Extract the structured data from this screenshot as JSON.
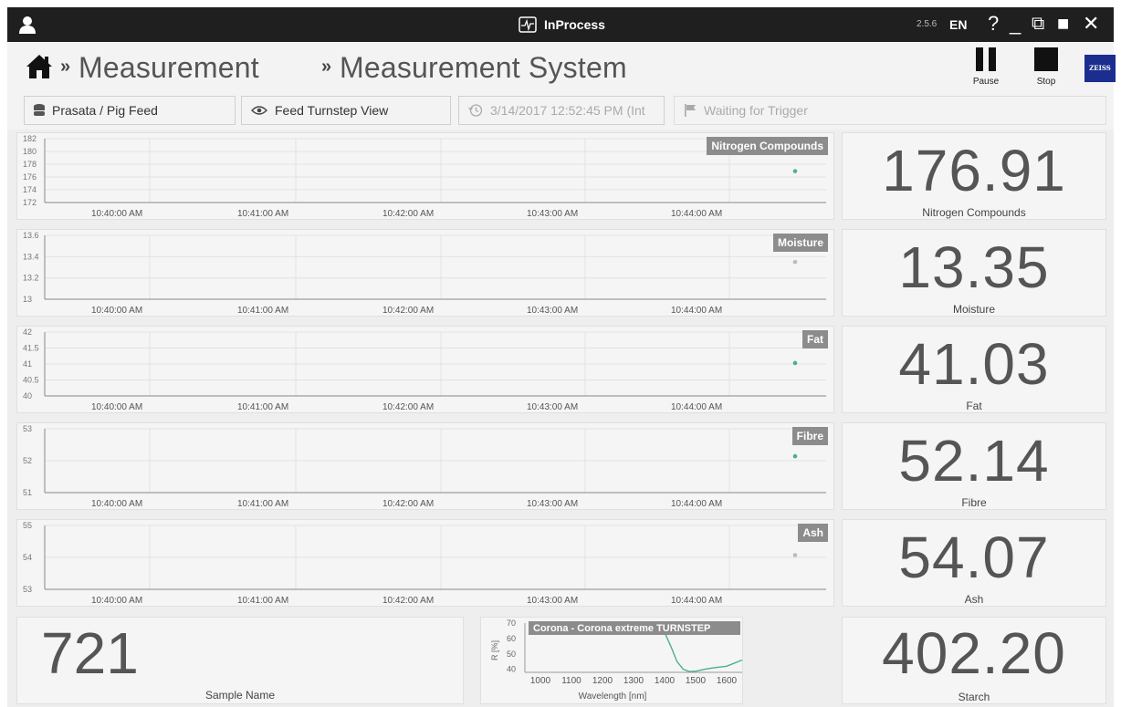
{
  "titlebar": {
    "app_name": "InProcess",
    "version": "2.5.6",
    "language": "EN",
    "controls": [
      "?",
      "_",
      "⧉",
      "■",
      "✕"
    ]
  },
  "breadcrumb": {
    "items": [
      "Measurement",
      "Measurement System"
    ],
    "separator": "»"
  },
  "tools": {
    "pause_label": "Pause",
    "stop_label": "Stop",
    "logo_text": "ZEISS"
  },
  "toolbar": {
    "product": "Prasata / Pig Feed",
    "view": "Feed Turnstep View",
    "timestamp": "3/14/2017 12:52:45 PM (Int",
    "status": "Waiting for Trigger"
  },
  "time_axis_labels": [
    "10:40:00 AM",
    "10:41:00 AM",
    "10:42:00 AM",
    "10:43:00 AM",
    "10:44:00 AM"
  ],
  "chart_data": [
    {
      "type": "scatter",
      "name": "Nitrogen Compounds",
      "yticks": [
        "182",
        "180",
        "178",
        "176",
        "174",
        "172"
      ],
      "ylim": [
        172,
        182
      ],
      "point_y": 176.91,
      "point_color": "#4caf8a",
      "x": [
        "10:40:00 AM",
        "10:41:00 AM",
        "10:42:00 AM",
        "10:43:00 AM",
        "10:44:00 AM"
      ]
    },
    {
      "type": "scatter",
      "name": "Moisture",
      "yticks": [
        "13.6",
        "13.4",
        "13.2",
        "13"
      ],
      "ylim": [
        13.0,
        13.6
      ],
      "point_y": 13.35,
      "point_color": "#bbbbbb",
      "x": [
        "10:40:00 AM",
        "10:41:00 AM",
        "10:42:00 AM",
        "10:43:00 AM",
        "10:44:00 AM"
      ]
    },
    {
      "type": "scatter",
      "name": "Fat",
      "yticks": [
        "42",
        "41.5",
        "41",
        "40.5",
        "40"
      ],
      "ylim": [
        40,
        42
      ],
      "point_y": 41.03,
      "point_color": "#4caf8a",
      "x": [
        "10:40:00 AM",
        "10:41:00 AM",
        "10:42:00 AM",
        "10:43:00 AM",
        "10:44:00 AM"
      ]
    },
    {
      "type": "scatter",
      "name": "Fibre",
      "yticks": [
        "53",
        "52",
        "51"
      ],
      "ylim": [
        51,
        53
      ],
      "point_y": 52.14,
      "point_color": "#4caf8a",
      "x": [
        "10:40:00 AM",
        "10:41:00 AM",
        "10:42:00 AM",
        "10:43:00 AM",
        "10:44:00 AM"
      ]
    },
    {
      "type": "scatter",
      "name": "Ash",
      "yticks": [
        "55",
        "54",
        "53"
      ],
      "ylim": [
        53,
        55
      ],
      "point_y": 54.07,
      "point_color": "#bbbbbb",
      "x": [
        "10:40:00 AM",
        "10:41:00 AM",
        "10:42:00 AM",
        "10:43:00 AM",
        "10:44:00 AM"
      ]
    },
    {
      "type": "line",
      "name": "Corona - Corona extreme TURNSTEP",
      "xlabel": "Wavelength [nm]",
      "ylabel": "R [%]",
      "xticks": [
        "1000",
        "1100",
        "1200",
        "1300",
        "1400",
        "1500",
        "1600"
      ],
      "yticks": [
        "70",
        "60",
        "50",
        "40"
      ],
      "xlim": [
        950,
        1650
      ],
      "ylim": [
        38,
        70
      ],
      "series_color": "#4caf8a",
      "x": [
        1350,
        1380,
        1400,
        1420,
        1440,
        1460,
        1480,
        1500,
        1530,
        1560,
        1600,
        1650
      ],
      "y": [
        70,
        68,
        64,
        55,
        45,
        40,
        38.5,
        38.7,
        40,
        41,
        42,
        46
      ]
    }
  ],
  "values": [
    {
      "value": "176.91",
      "label": "Nitrogen Compounds"
    },
    {
      "value": "13.35",
      "label": "Moisture"
    },
    {
      "value": "41.03",
      "label": "Fat"
    },
    {
      "value": "52.14",
      "label": "Fibre"
    },
    {
      "value": "54.07",
      "label": "Ash"
    },
    {
      "value": "402.20",
      "label": "Starch"
    }
  ],
  "sample": {
    "value": "721",
    "label": "Sample Name"
  }
}
